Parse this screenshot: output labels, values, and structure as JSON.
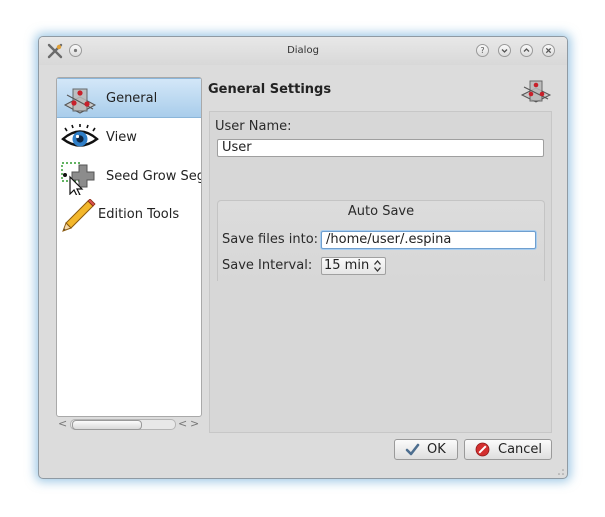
{
  "window": {
    "title": "Dialog",
    "buttons": {
      "help": "?",
      "minimize": "⌄",
      "maximize": "⌃",
      "close": "×"
    }
  },
  "sidebar": {
    "items": [
      {
        "label": "General",
        "icon": "espina-logo-icon",
        "selected": true
      },
      {
        "label": "View",
        "icon": "eye-icon",
        "selected": false
      },
      {
        "label": "Seed Grow Seg",
        "icon": "seed-grow-icon",
        "selected": false
      },
      {
        "label": "Edition Tools",
        "icon": "pencil-icon",
        "selected": false
      }
    ],
    "scroll_left": "<",
    "scroll_left2": "<",
    "scroll_right": ">"
  },
  "settings": {
    "title": "General Settings",
    "user_name_label": "User Name:",
    "user_name_value": "User",
    "auto_save": {
      "title": "Auto Save",
      "save_files_label": "Save files into:",
      "save_files_value": "/home/user/.espina",
      "save_interval_label": "Save Interval:",
      "save_interval_value": "15 min"
    }
  },
  "footer": {
    "ok_label": "OK",
    "cancel_label": "Cancel"
  },
  "colors": {
    "selection": "#a9cdeb",
    "window_bg": "#dcdcdc",
    "focus_border": "#6f9fcf",
    "logo_red": "#c8202a"
  }
}
